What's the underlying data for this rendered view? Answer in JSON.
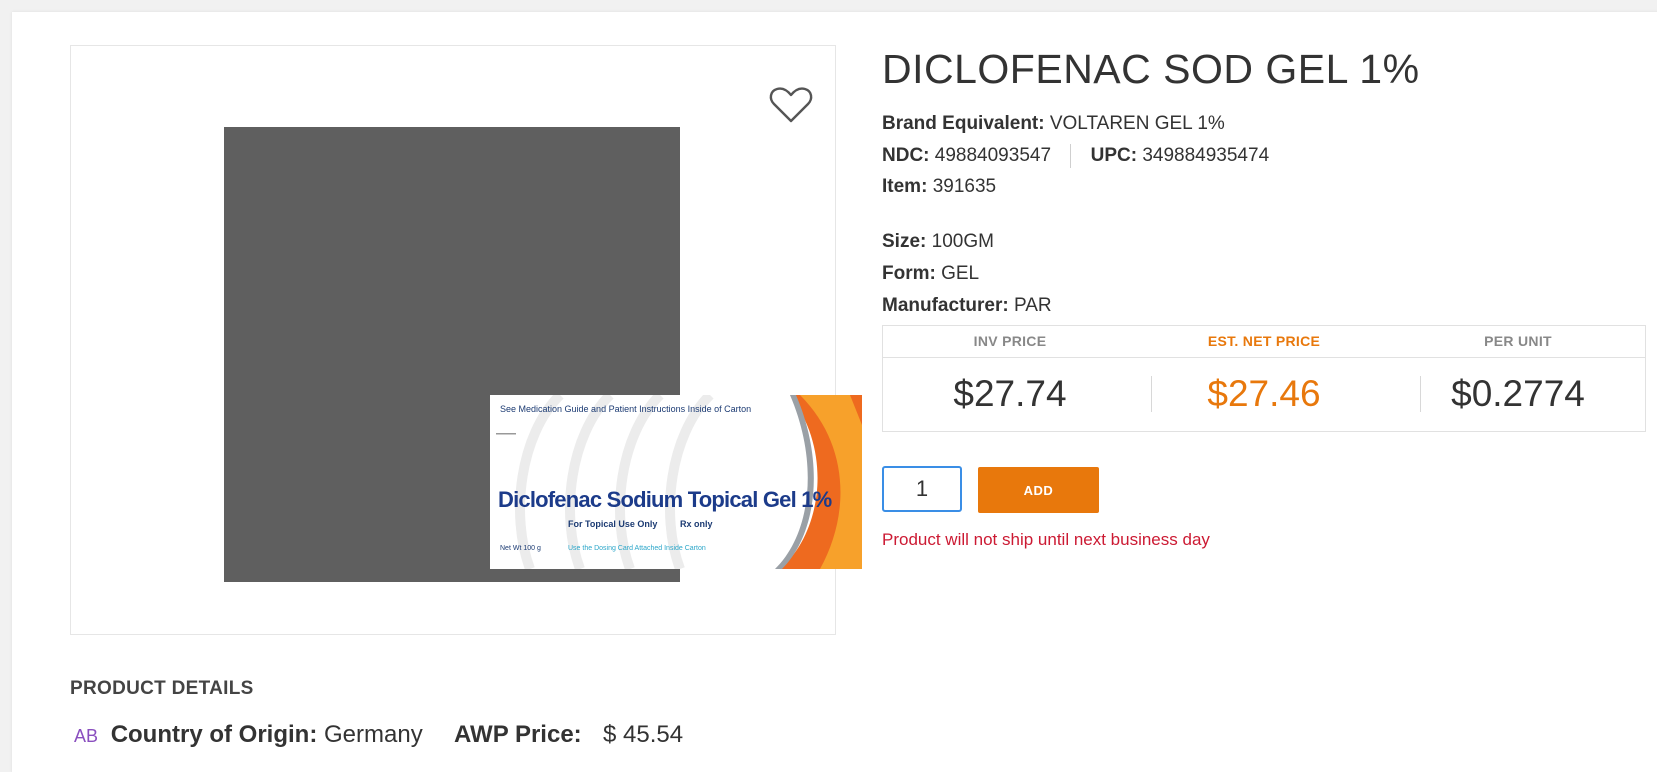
{
  "product": {
    "title": "DICLOFENAC SOD GEL 1%",
    "brand_label": "Brand Equivalent:",
    "brand_value": "VOLTAREN GEL 1%",
    "ndc_label": "NDC:",
    "ndc_value": "49884093547",
    "upc_label": "UPC:",
    "upc_value": "349884935474",
    "item_label": "Item:",
    "item_value": "391635",
    "size_label": "Size:",
    "size_value": "100GM",
    "form_label": "Form:",
    "form_value": "GEL",
    "manufacturer_label": "Manufacturer:",
    "manufacturer_value": "PAR"
  },
  "image": {
    "line1": "See Medication Guide and Patient Instructions Inside of Carton",
    "line2": "Diclofenac Sodium Topical Gel 1%",
    "line3": "For Topical Use Only",
    "line3b": "Rx only",
    "line4": "Net Wt 100 g",
    "line5": "Use the Dosing Card Attached Inside Carton"
  },
  "pricing": {
    "inv_label": "INV PRICE",
    "inv_value": "$27.74",
    "net_label": "EST. NET PRICE",
    "net_value": "$27.46",
    "unit_label": "PER UNIT",
    "unit_value": "$0.2774"
  },
  "cart": {
    "quantity": "1",
    "add_label": "ADD",
    "warning": "Product will not ship until next business day"
  },
  "details": {
    "heading": "PRODUCT DETAILS",
    "badge": "AB",
    "origin_label": "Country of Origin:",
    "origin_value": "Germany",
    "awp_label": "AWP Price:",
    "awp_value": "$ 45.54"
  },
  "colors": {
    "accent": "#e8780c",
    "warning": "#cc1a33",
    "badge": "#8a4fbf",
    "focus": "#3a8ee6"
  },
  "icons": {
    "favorite": "heart-outline-icon"
  }
}
